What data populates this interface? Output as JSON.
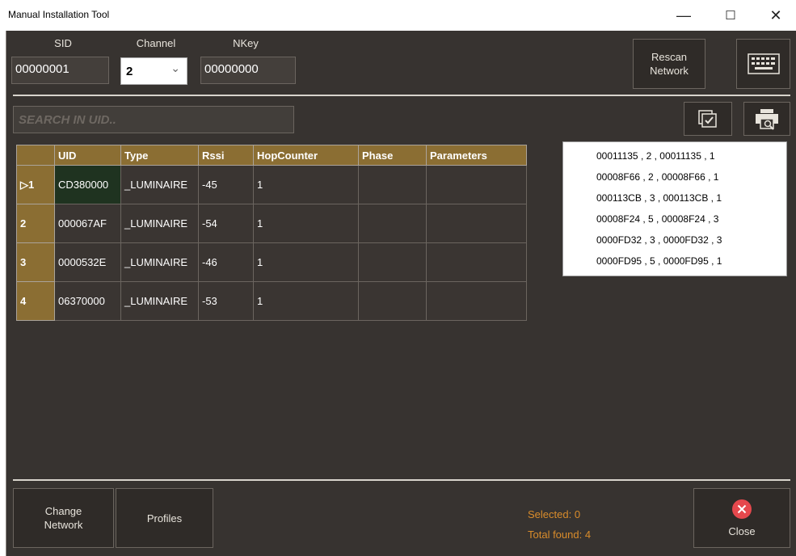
{
  "window": {
    "title": "Manual Installation Tool",
    "minimize_glyph": "—",
    "maximize_glyph": "☐",
    "close_glyph": "✕"
  },
  "header": {
    "sid_label": "SID",
    "sid_value": "00000001",
    "channel_label": "Channel",
    "channel_value": "2",
    "channel_arrow": "⌄",
    "nkey_label": "NKey",
    "nkey_value": "00000000",
    "rescan_label": "Rescan\nNetwork",
    "keyboard_icon": "keyboard-icon"
  },
  "search": {
    "placeholder": "SEARCH IN UID.."
  },
  "toolbar": {
    "select_all_icon": "checkbox-stack-icon",
    "print_preview_icon": "print-search-icon"
  },
  "table": {
    "columns": [
      "",
      "UID",
      "Type",
      "Rssi",
      "HopCounter",
      "Phase",
      "Parameters"
    ],
    "rows": [
      {
        "row_header": "▷1",
        "uid": "CD380000",
        "type": "_LUMINAIRE",
        "rssi": "-45",
        "hop": "1",
        "phase": "",
        "parameters": ""
      },
      {
        "row_header": "2",
        "uid": "000067AF",
        "type": "_LUMINAIRE",
        "rssi": "-54",
        "hop": "1",
        "phase": "",
        "parameters": ""
      },
      {
        "row_header": "3",
        "uid": "0000532E",
        "type": "_LUMINAIRE",
        "rssi": "-46",
        "hop": "1",
        "phase": "",
        "parameters": ""
      },
      {
        "row_header": "4",
        "uid": "06370000",
        "type": "_LUMINAIRE",
        "rssi": "-53",
        "hop": "1",
        "phase": "",
        "parameters": ""
      }
    ]
  },
  "popup": {
    "items": [
      "00011135 , 2 , 00011135 , 1",
      "00008F66 , 2 , 00008F66 , 1",
      "000113CB , 3 , 000113CB , 1",
      "00008F24 , 5 , 00008F24 , 3",
      "0000FD32 , 3 , 0000FD32 , 3",
      "0000FD95 , 5 , 0000FD95 , 1"
    ]
  },
  "footer": {
    "change_network_label": "Change\nNetwork",
    "profiles_label": "Profiles",
    "selected_text": "Selected: 0",
    "total_found_text": "Total found: 4",
    "close_label": "Close"
  },
  "colors": {
    "background": "#373330",
    "header_gold": "#8b6e33",
    "status_orange": "#d98c2b",
    "close_red": "#e5484d"
  }
}
